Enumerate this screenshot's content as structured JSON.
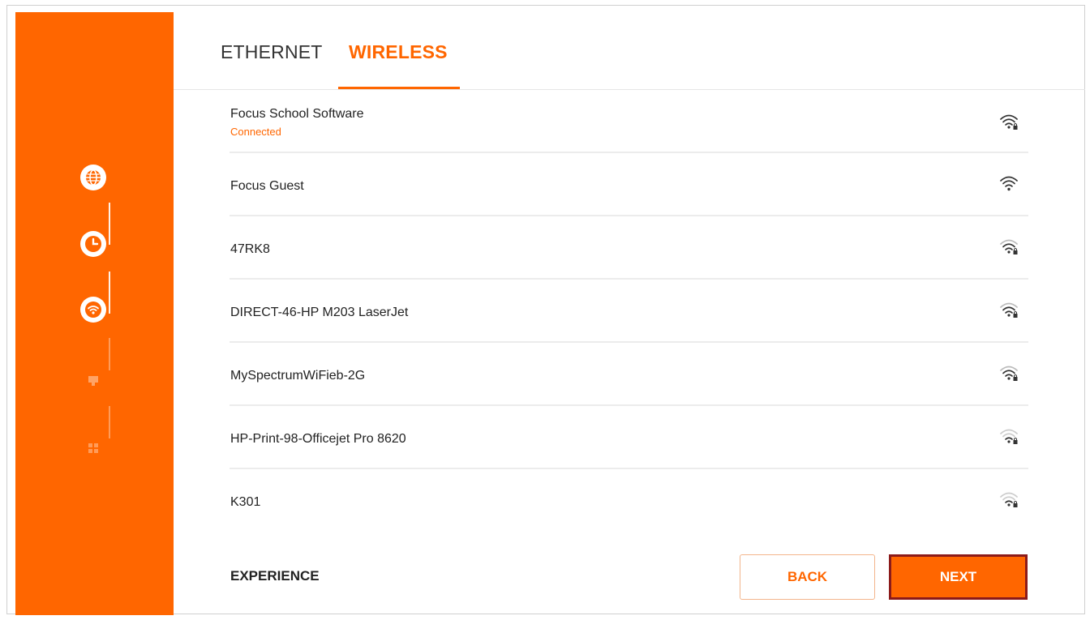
{
  "tabs": {
    "ethernet": "ETHERNET",
    "wireless": "WIRELESS"
  },
  "steps": [
    {
      "icon": "globe-icon",
      "state": "done"
    },
    {
      "icon": "clock-icon",
      "state": "done"
    },
    {
      "icon": "wifi-icon",
      "state": "active"
    },
    {
      "icon": "monitor-icon",
      "state": "pending"
    },
    {
      "icon": "apps-icon",
      "state": "pending"
    }
  ],
  "networks": [
    {
      "name": "Focus School Software",
      "status": "Connected",
      "secured": true,
      "signal": "strong"
    },
    {
      "name": "Focus Guest",
      "status": "",
      "secured": false,
      "signal": "strong"
    },
    {
      "name": "47RK8",
      "status": "",
      "secured": true,
      "signal": "medium"
    },
    {
      "name": "DIRECT-46-HP M203 LaserJet",
      "status": "",
      "secured": true,
      "signal": "medium"
    },
    {
      "name": "MySpectrumWiFieb-2G",
      "status": "",
      "secured": true,
      "signal": "medium"
    },
    {
      "name": "HP-Print-98-Officejet Pro 8620",
      "status": "",
      "secured": true,
      "signal": "weak"
    },
    {
      "name": "K301",
      "status": "",
      "secured": true,
      "signal": "weak"
    }
  ],
  "footer": {
    "label": "EXPERIENCE",
    "back_label": "BACK",
    "next_label": "NEXT"
  },
  "colors": {
    "accent": "#ff6600",
    "next_border": "#8b1a1a"
  }
}
